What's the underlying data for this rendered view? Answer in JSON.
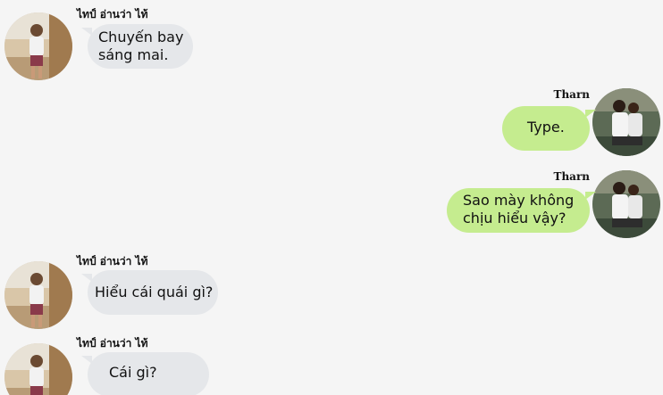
{
  "messages": [
    {
      "side": "left",
      "sender": "ไทป์ อ่านว่า ไท้",
      "lines": [
        "Chuyến bay",
        "sáng mai."
      ]
    },
    {
      "side": "right",
      "sender": "Tharn",
      "lines": [
        "Type."
      ]
    },
    {
      "side": "right",
      "sender": "Tharn",
      "lines": [
        "Sao mày không",
        "chịu hiểu vậy?"
      ]
    },
    {
      "side": "left",
      "sender": "ไทป์ อ่านว่า ไท้",
      "lines": [
        "Hiểu cái quái gì?"
      ]
    },
    {
      "side": "left",
      "sender": "ไทป์ อ่านว่า ไท้",
      "lines": [
        "Cái gì?"
      ]
    }
  ],
  "colors": {
    "background": "#f5f5f5",
    "received_bubble": "#e5e7ea",
    "sent_bubble": "#c5ec8f"
  },
  "icons": {
    "type_avatar": "person-photo-beach",
    "tharn_avatar": "person-photo-couple"
  }
}
